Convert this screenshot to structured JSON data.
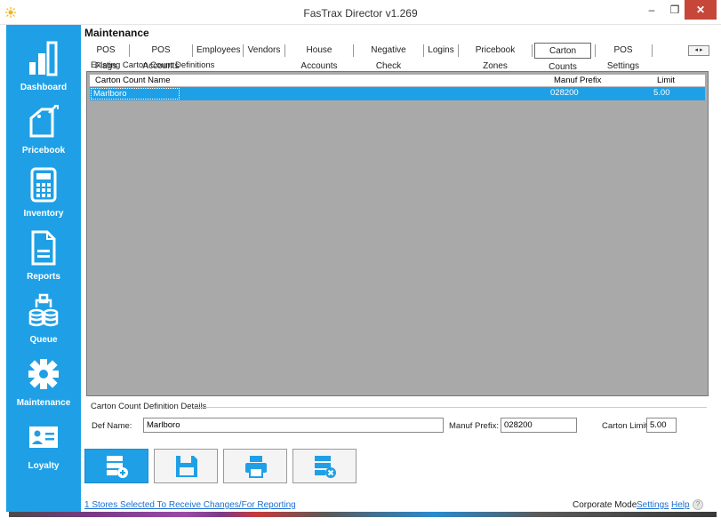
{
  "window": {
    "title": "FasTrax Director v1.269",
    "minimize": "–",
    "maximize": "❐",
    "close": "✕"
  },
  "sidebar": {
    "items": [
      {
        "label": "Dashboard",
        "icon": "bar-chart-icon"
      },
      {
        "label": "Pricebook",
        "icon": "price-tag-icon"
      },
      {
        "label": "Inventory",
        "icon": "calculator-icon"
      },
      {
        "label": "Reports",
        "icon": "document-icon"
      },
      {
        "label": "Queue",
        "icon": "database-queue-icon"
      },
      {
        "label": "Maintenance",
        "icon": "gear-icon"
      },
      {
        "label": "Loyalty",
        "icon": "id-card-icon"
      }
    ],
    "color": "#1fa0e6"
  },
  "section": {
    "title": "Maintenance"
  },
  "tabs": [
    {
      "label": "POS Flags"
    },
    {
      "label": "POS Accounts"
    },
    {
      "label": "Employees"
    },
    {
      "label": "Vendors"
    },
    {
      "label": "House Accounts"
    },
    {
      "label": "Negative Check"
    },
    {
      "label": "Logins"
    },
    {
      "label": "Pricebook Zones"
    },
    {
      "label": "Carton Counts",
      "active": true
    },
    {
      "label": "POS Settings"
    }
  ],
  "tab_scroll": "◂ ▸",
  "grid": {
    "group_label": "Existing Carton Count Definitions",
    "columns": [
      "Carton Count Name",
      "Manuf Prefix",
      "Limit"
    ],
    "rows": [
      {
        "name": "Marlboro",
        "prefix": "028200",
        "limit": "5.00",
        "selected": true
      }
    ]
  },
  "details": {
    "group_label": "Carton Count Definition Details",
    "def_name_label": "Def Name:",
    "def_name_value": "Marlboro",
    "prefix_label": "Manuf Prefix:",
    "prefix_value": "028200",
    "limit_label": "Carton Limit:",
    "limit_value": "5.00"
  },
  "actions": [
    {
      "name": "add",
      "icon": "database-add-icon"
    },
    {
      "name": "save",
      "icon": "save-icon"
    },
    {
      "name": "print",
      "icon": "printer-icon"
    },
    {
      "name": "delete",
      "icon": "database-delete-icon"
    }
  ],
  "status": {
    "stores_link": "1 Stores Selected To Receive Changes/For Reporting",
    "mode": "Corporate Mode",
    "settings": "Settings",
    "help": "Help",
    "help_icon": "?"
  }
}
